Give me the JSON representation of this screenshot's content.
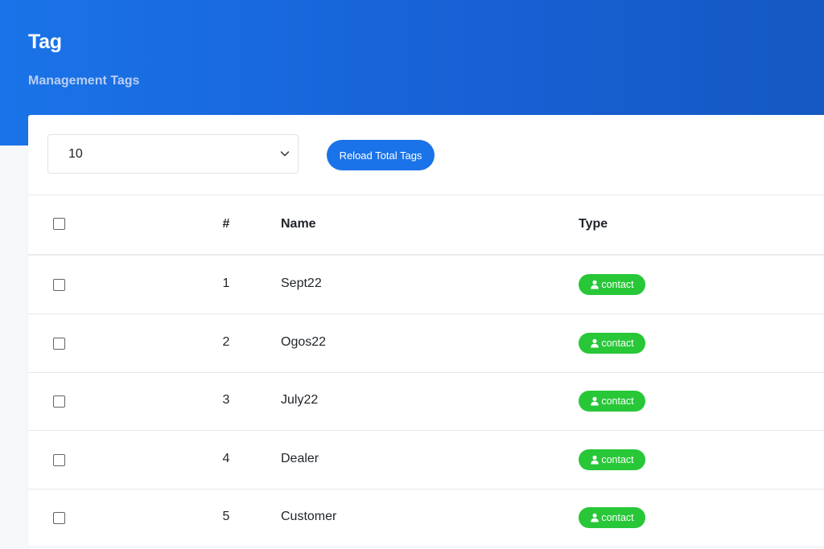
{
  "header": {
    "title": "Tag",
    "subtitle": "Management Tags"
  },
  "toolbar": {
    "page_size": "10",
    "reload_label": "Reload Total Tags"
  },
  "table": {
    "columns": {
      "number": "#",
      "name": "Name",
      "type": "Type"
    },
    "rows": [
      {
        "number": "1",
        "name": "Sept22",
        "type": "contact"
      },
      {
        "number": "2",
        "name": "Ogos22",
        "type": "contact"
      },
      {
        "number": "3",
        "name": "July22",
        "type": "contact"
      },
      {
        "number": "4",
        "name": "Dealer",
        "type": "contact"
      },
      {
        "number": "5",
        "name": "Customer",
        "type": "contact"
      }
    ]
  },
  "colors": {
    "header_bg": "#1a73e8",
    "accent": "#1a73e8",
    "badge_green": "#28c738"
  },
  "icons": {
    "select_chevron": "chevron-down-icon",
    "badge_icon": "user-icon"
  }
}
